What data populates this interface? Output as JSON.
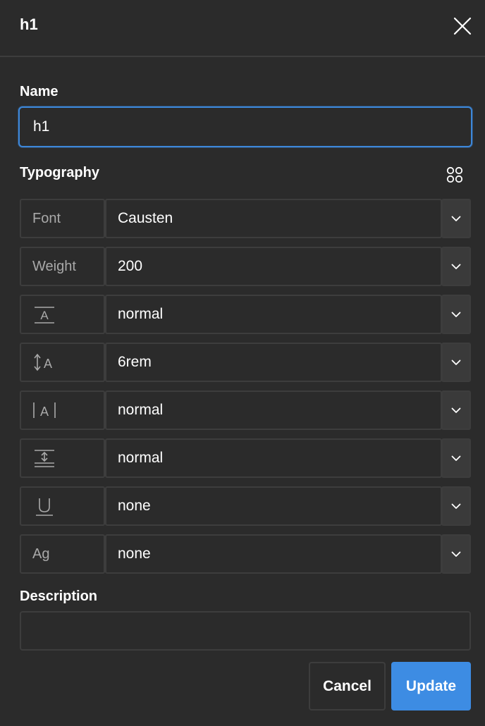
{
  "dialog": {
    "title": "h1"
  },
  "name": {
    "label": "Name",
    "value": "h1"
  },
  "typography": {
    "label": "Typography",
    "rows": [
      {
        "label": "Font",
        "icon": "",
        "value": "Causten"
      },
      {
        "label": "Weight",
        "icon": "",
        "value": "200"
      },
      {
        "label": "",
        "icon": "font-size-icon",
        "value": "normal"
      },
      {
        "label": "",
        "icon": "line-height-icon",
        "value": "6rem"
      },
      {
        "label": "",
        "icon": "letter-spacing-icon",
        "value": "normal"
      },
      {
        "label": "",
        "icon": "vertical-spacing-icon",
        "value": "normal"
      },
      {
        "label": "",
        "icon": "text-decoration-icon",
        "value": "none"
      },
      {
        "label": "Ag",
        "icon": "text-transform-icon",
        "value": "none"
      }
    ]
  },
  "description": {
    "label": "Description",
    "value": ""
  },
  "buttons": {
    "cancel": "Cancel",
    "update": "Update"
  },
  "colors": {
    "background": "#2b2b2b",
    "border": "#3d3d3d",
    "focus": "#3d87d9",
    "primary": "#3d8ce3",
    "muted_text": "#a9a9a9"
  }
}
